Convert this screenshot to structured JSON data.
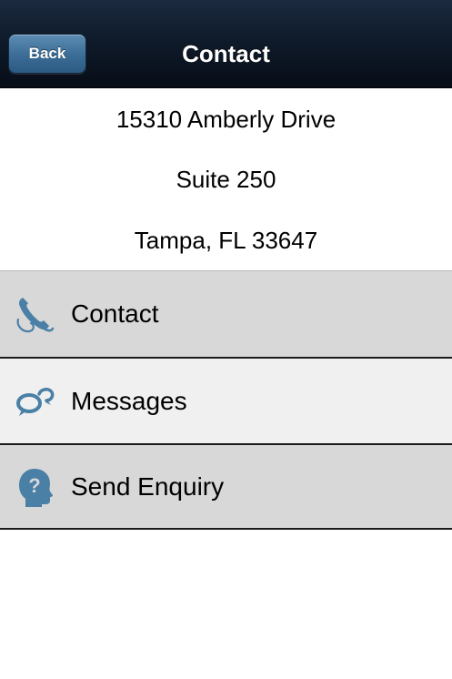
{
  "navbar": {
    "back_label": "Back",
    "title": "Contact"
  },
  "address": {
    "line1": "15310 Amberly Drive",
    "line2": "Suite 250",
    "line3": "Tampa, FL 33647"
  },
  "menu": {
    "items": [
      {
        "label": "Contact",
        "icon": "phone-icon"
      },
      {
        "label": "Messages",
        "icon": "chat-bubbles-icon"
      },
      {
        "label": "Send Enquiry",
        "icon": "question-head-icon"
      }
    ]
  },
  "colors": {
    "navbar": "#0f1b2b",
    "back_button": "#3d6f98",
    "icon": "#4a7fa6",
    "row_dark": "#d8d8d8",
    "row_light": "#f0f0f0"
  }
}
